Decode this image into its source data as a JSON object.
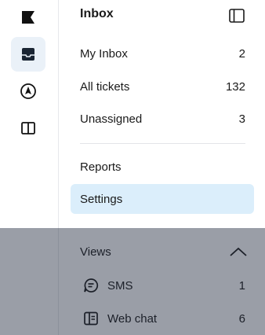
{
  "rail": {
    "items": [
      {
        "name": "flag",
        "active": false
      },
      {
        "name": "inbox",
        "active": true
      },
      {
        "name": "navigation",
        "active": false
      },
      {
        "name": "sidebar-panel",
        "active": false
      }
    ]
  },
  "panel": {
    "title": "Inbox",
    "items": [
      {
        "label": "My Inbox",
        "count": "2"
      },
      {
        "label": "All tickets",
        "count": "132"
      },
      {
        "label": "Unassigned",
        "count": "3"
      }
    ],
    "secondary": [
      {
        "label": "Reports",
        "selected": false
      },
      {
        "label": "Settings",
        "selected": true
      }
    ],
    "views": {
      "label": "Views",
      "expanded": true,
      "items": [
        {
          "label": "SMS",
          "count": "1",
          "icon": "message-icon"
        },
        {
          "label": "Web chat",
          "count": "6",
          "icon": "web-chat-icon"
        }
      ]
    }
  },
  "colors": {
    "selected_bg": "#dbeefb",
    "active_rail_bg": "#eaf1f8",
    "overlay": "rgba(30,40,60,0.45)"
  }
}
